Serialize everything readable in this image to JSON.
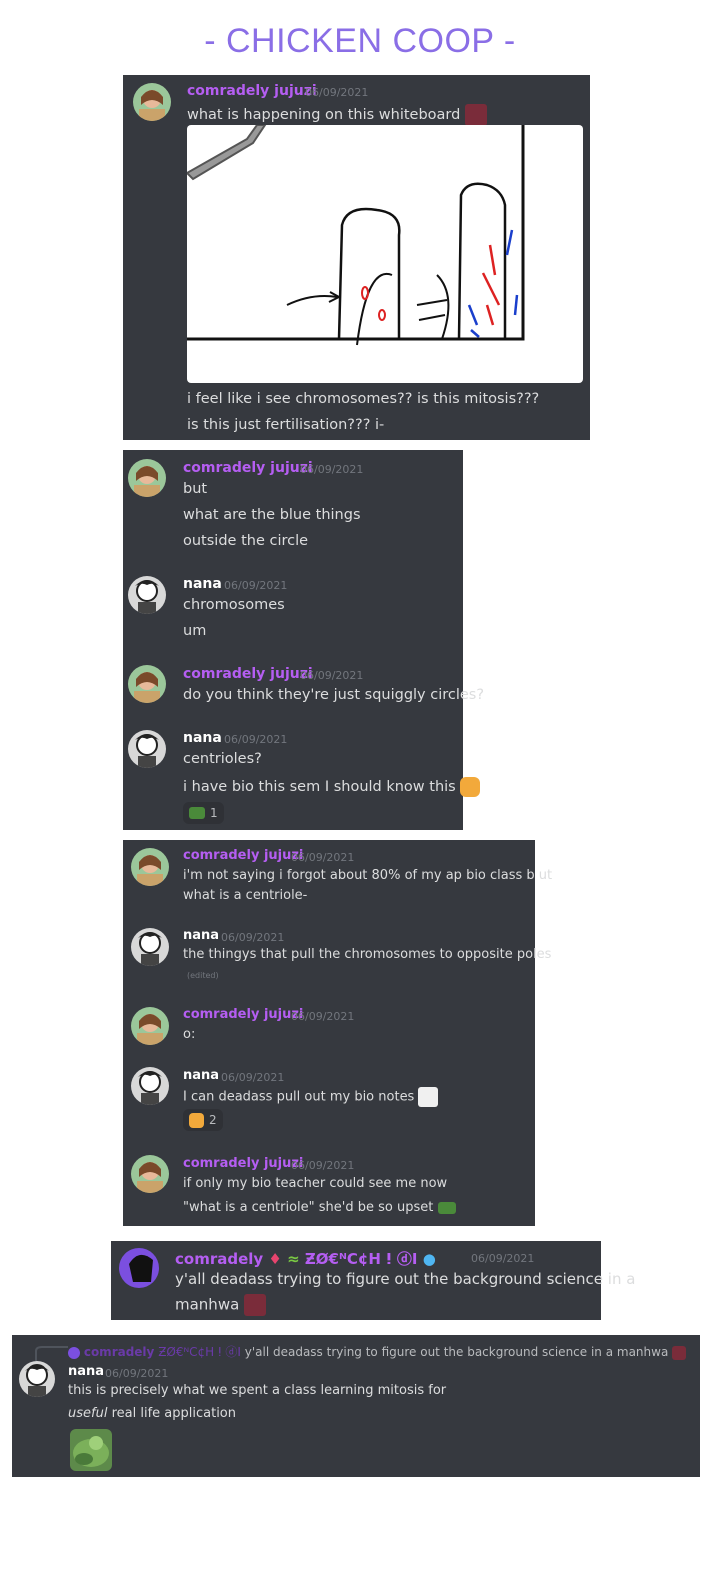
{
  "page": {
    "title": "- CHICKEN COOP -"
  },
  "colors": {
    "panel": "#36393f",
    "name_purple": "#b55ef2",
    "title": "#8a6ee6"
  },
  "panel1": {
    "author": "comradely jujuzi",
    "time": "06/09/2021",
    "line1": "what is happening on this whiteboard",
    "line2": "i feel like i see chromosomes?? is this mitosis???",
    "line3": "is this just fertilisation??? i-"
  },
  "panel2": {
    "m1": {
      "author": "comradely jujuzi",
      "time": "06/09/2021",
      "lines": [
        "but",
        "what are the blue things",
        "outside the circle"
      ]
    },
    "m2": {
      "author": "nana",
      "time": "06/09/2021",
      "lines": [
        "chromosomes",
        "um"
      ]
    },
    "m3": {
      "author": "comradely jujuzi",
      "time": "06/09/2021",
      "lines": [
        "do you think they're just squiggly circles?"
      ]
    },
    "m4": {
      "author": "nana",
      "time": "06/09/2021",
      "lines": [
        "centrioles?",
        "i have bio this sem I should know this"
      ],
      "reaction_count": "1"
    }
  },
  "panel3": {
    "m1": {
      "author": "comradely jujuzi",
      "time": "06/09/2021",
      "lines": [
        "i'm not saying i forgot about 80% of my ap bio class b ut",
        "what is a centriole-"
      ]
    },
    "m2": {
      "author": "nana",
      "time": "06/09/2021",
      "lines": [
        "the thingys that pull the chromosomes to opposite poles"
      ],
      "edited": "(edited)"
    },
    "m3": {
      "author": "comradely jujuzi",
      "time": "06/09/2021",
      "lines": [
        "o:"
      ]
    },
    "m4": {
      "author": "nana",
      "time": "06/09/2021",
      "lines": [
        "I can deadass pull out my bio notes"
      ],
      "reaction_count": "2"
    },
    "m5": {
      "author": "comradely jujuzi",
      "time": "06/09/2021",
      "lines": [
        "if only my bio teacher could see me now",
        "\"what is a centriole\" she'd be so upset"
      ]
    }
  },
  "panel4": {
    "author": "comradely",
    "author_suffix": "ƵØ€ᴺC¢H ⵑ ⓓI",
    "time": "06/09/2021",
    "lines": [
      "y'all deadass trying to figure out the background science in a",
      "manhwa"
    ]
  },
  "panel5": {
    "reply_author": "comradely",
    "reply_suffix": "ƵØ€ᴺC¢H ⵑ ⓓI",
    "reply_text": "y'all deadass trying to figure out the background science in a manhwa",
    "author": "nana",
    "time": "06/09/2021",
    "line1": "this is  precisely what we spent a class learning mitosis for",
    "line2_em": "useful",
    "line2_rest": " real life application"
  },
  "icons": {
    "avatar_jujuzi": "avatar-girl-icon",
    "avatar_nana": "avatar-manga-icon"
  }
}
